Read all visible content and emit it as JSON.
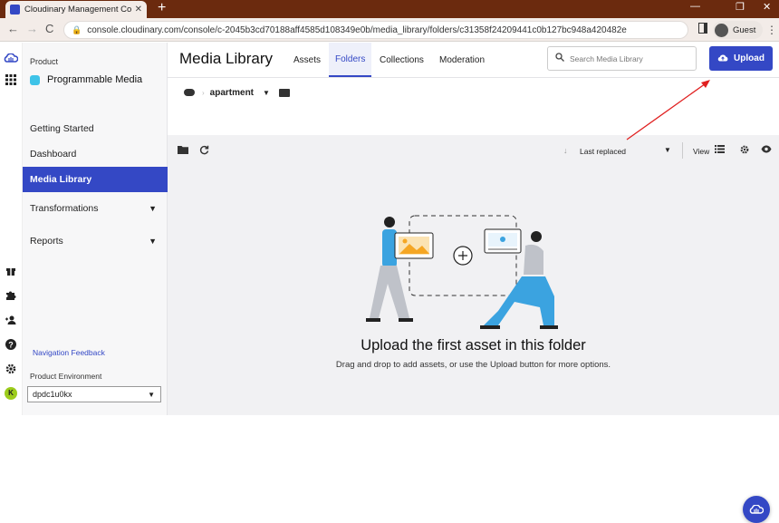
{
  "browser": {
    "tab_title": "Cloudinary Management Console",
    "new_tab": "+",
    "url": "console.cloudinary.com/console/c-2045b3cd70188aff4585d108349e0b/media_library/folders/c31358f24209441c0b127bc948a420482e",
    "profile": "Guest",
    "tab_close": "✕",
    "win_min": "—",
    "win_max": "❐",
    "win_close": "✕",
    "back": "←",
    "forward": "→",
    "reload": "C",
    "kebab": "⋮"
  },
  "rail": {
    "user_initial": "K"
  },
  "sidebar": {
    "product_label": "Product",
    "product_name": "Programmable Media",
    "items": [
      {
        "label": "Getting Started"
      },
      {
        "label": "Dashboard"
      },
      {
        "label": "Media Library"
      },
      {
        "label": "Transformations"
      },
      {
        "label": "Reports"
      }
    ],
    "nav_feedback": "Navigation Feedback",
    "env_label": "Product Environment",
    "env_value": "dpdc1u0kx"
  },
  "header": {
    "title": "Media Library",
    "tabs": [
      "Assets",
      "Folders",
      "Collections",
      "Moderation"
    ],
    "search_placeholder": "Search Media Library",
    "upload_label": "Upload"
  },
  "breadcrumb": {
    "folder": "apartment"
  },
  "toolbar": {
    "sort_label": "Last replaced",
    "view_label": "View"
  },
  "empty_state": {
    "title": "Upload the first asset in this folder",
    "subtitle": "Drag and drop to add assets, or use the Upload button for more options."
  },
  "colors": {
    "brand": "#3448c5",
    "annotation_arrow": "#e02020",
    "browser_frame": "#6b2a0e"
  }
}
